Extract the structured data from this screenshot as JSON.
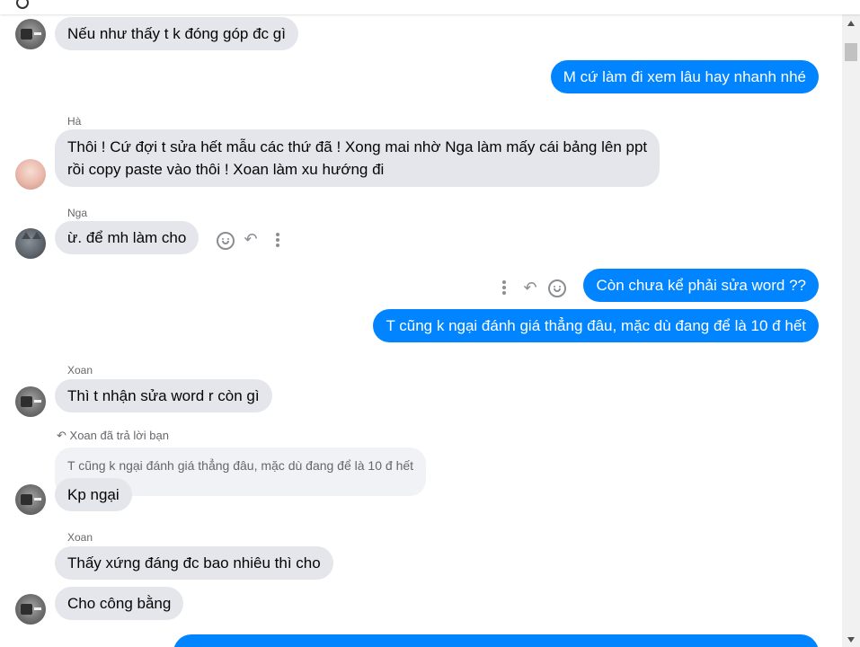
{
  "messages": [
    {
      "type": "in",
      "text": "Nếu như thấy t k đóng góp đc gì"
    },
    {
      "type": "out",
      "text": "M cứ làm đi xem lâu hay nhanh nhé"
    },
    {
      "type": "in",
      "sender": "Hà",
      "line1": "Thôi ! Cứ đợi t sửa hết mẫu các thứ đã ! Xong mai nhờ Nga làm mấy cái bảng lên ppt",
      "line2": "rồi copy paste vào thôi ! Xoan làm xu hướng đi"
    },
    {
      "type": "in",
      "sender": "Nga",
      "text": "ừ. để mh làm cho"
    },
    {
      "type": "out",
      "text": "Còn chưa kể phải sửa word ??"
    },
    {
      "type": "out",
      "text": "T cũng k ngại đánh giá thẳng đâu, mặc dù đang để là 10 đ hết"
    },
    {
      "type": "in",
      "sender": "Xoan",
      "text": "Thì t nhận sửa word r còn gì"
    },
    {
      "type": "in",
      "reply_note": "Xoan đã trả lời bạn",
      "quoted": "T cũng k ngại đánh giá thẳng đâu, mặc dù đang để là 10 đ hết",
      "text": "Kp ngại"
    },
    {
      "type": "in",
      "sender": "Xoan",
      "text": "Thấy xứng đáng đc bao nhiêu thì cho"
    },
    {
      "type": "in",
      "text": "Cho công bằng"
    }
  ],
  "icons": {
    "react": "smile-icon",
    "reply": "reply-icon",
    "more": "more-icon",
    "reply_note": "reply-arrow-icon"
  },
  "colors": {
    "outgoing": "#0084ff",
    "incoming": "#e4e6eb",
    "quote": "#f0f2f5",
    "meta": "#65676b"
  }
}
